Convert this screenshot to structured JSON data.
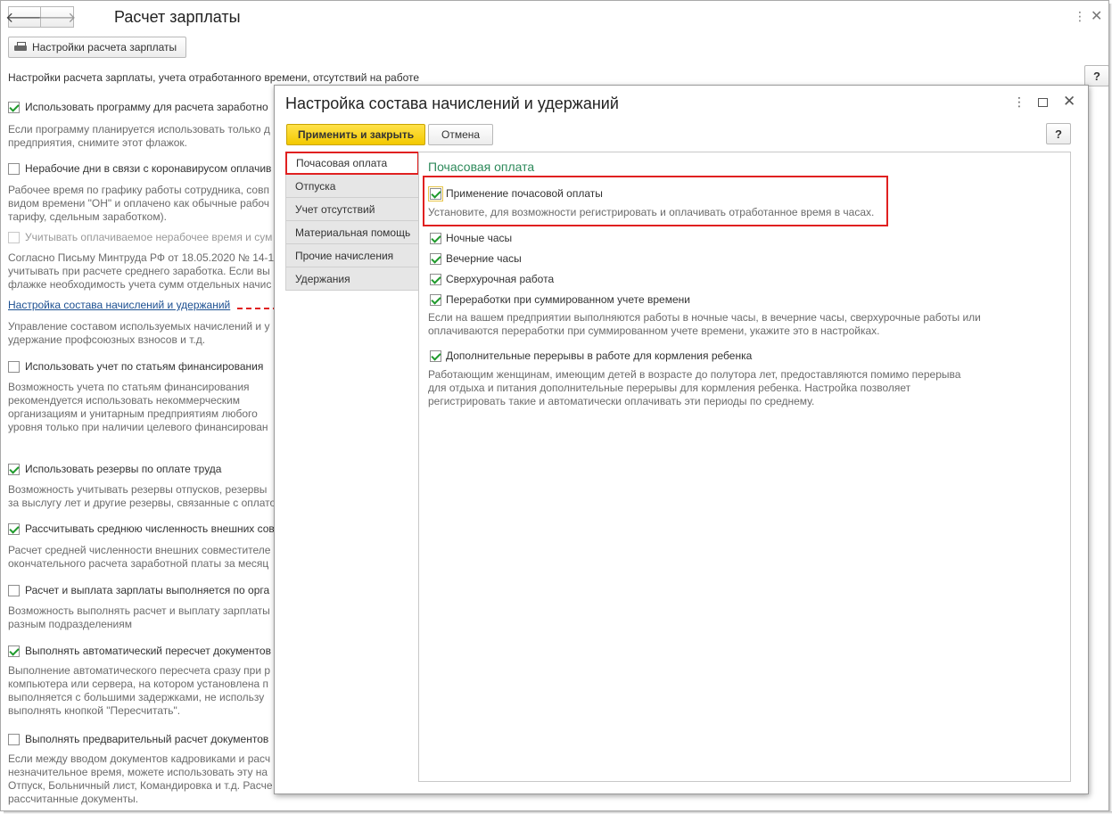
{
  "header": {
    "title": "Расчет зарплаты",
    "settings_button": "Настройки расчета зарплаты",
    "description": "Настройки расчета зарплаты, учета отработанного времени, отсутствий на работе",
    "help": "?"
  },
  "main": {
    "items": [
      {
        "label": "Использовать программу для расчета заработно",
        "checked": true,
        "desc": [
          "Если программу планируется использовать только д",
          "предприятия, снимите этот флажок."
        ]
      },
      {
        "label": "Нерабочие дни в связи с коронавирусом оплачив",
        "checked": false,
        "desc": [
          "Рабочее время по графику работы сотрудника, совп",
          "видом времени \"ОН\" и оплачено как обычные рабоч",
          "тарифу, сдельным заработком)."
        ]
      },
      {
        "label": "Учитывать оплачиваемое нерабочее время и сум",
        "checked": false,
        "disabled": true,
        "desc": [
          "Согласно Письму Минтруда РФ от 18.05.2020 № 14-1",
          "учитывать при расчете среднего заработка. Если вы",
          "флажке необходимость учета сумм отдельных начис"
        ]
      },
      {
        "label": "Использовать учет по статьям финансирования",
        "checked": false,
        "desc": [
          "Возможность учета по статьям финансирования",
          "рекомендуется использовать некоммерческим",
          "организациям и унитарным предприятиям любого",
          "уровня только при наличии целевого финансирован"
        ]
      },
      {
        "label": "Использовать резервы по оплате труда",
        "checked": true,
        "desc": [
          "Возможность учитывать резервы отпусков,  резервы",
          "за выслугу лет и другие резервы, связанные с оплато"
        ]
      },
      {
        "label": "Рассчитывать среднюю численность внешних сов",
        "checked": true,
        "desc": [
          "Расчет средней численности внешних совместителе",
          "окончательного расчета заработной платы за месяц"
        ]
      },
      {
        "label": "Расчет и выплата зарплаты выполняется по орга",
        "checked": false,
        "desc": [
          "Возможность выполнять расчет и выплату зарплаты",
          "разным подразделениям"
        ]
      },
      {
        "label": "Выполнять автоматический пересчет документов",
        "checked": true,
        "desc": [
          "Выполнение автоматического пересчета сразу при р",
          "компьютера или сервера, на котором установлена п",
          "выполняется с большими задержками, не использу",
          "выполнять кнопкой \"Пересчитать\"."
        ]
      },
      {
        "label": "Выполнять предварительный расчет документов",
        "checked": false,
        "desc": [
          "Если между вводом документов кадровиками и расч",
          "незначительное время, можете использовать эту на",
          "Отпуск, Больничный лист, Командировка и т.д. Расче",
          "рассчитанные документы."
        ]
      }
    ],
    "link": "Настройка состава начислений и удержаний",
    "link_desc": [
      "Управление составом используемых начислений и у",
      "удержание профсоюзных взносов и т.д."
    ]
  },
  "dialog": {
    "title": "Настройка состава начислений и удержаний",
    "apply_button": "Применить и закрыть",
    "cancel_button": "Отмена",
    "help": "?",
    "tabs": [
      "Почасовая оплата",
      "Отпуска",
      "Учет отсутствий",
      "Материальная помощь",
      "Прочие начисления",
      "Удержания"
    ],
    "active_tab": "Почасовая оплата",
    "panel": {
      "heading": "Почасовая оплата",
      "hourly": {
        "label": "Применение почасовой оплаты",
        "checked": true,
        "desc": "Установите, для возможности регистрировать и оплачивать отработанное время в часах."
      },
      "night": {
        "label": "Ночные часы",
        "checked": true
      },
      "evening": {
        "label": "Вечерние часы",
        "checked": true
      },
      "overtime": {
        "label": "Сверхурочная работа",
        "checked": true
      },
      "summed": {
        "label": "Переработки при суммированном учете времени",
        "checked": true,
        "desc": [
          "Если на вашем предприятии выполняются работы в ночные часы, в вечерние часы, сверхурочные работы или",
          "оплачиваются переработки при суммированном учете времени, укажите это в настройках."
        ]
      },
      "feeding": {
        "label": "Дополнительные перерывы в работе для кормления ребенка",
        "checked": true,
        "desc": [
          "Работающим женщинам, имеющим детей в возрасте до полутора лет, предоставляются помимо перерыва",
          "для отдыха и питания дополнительные перерывы для кормления ребенка. Настройка позволяет",
          "регистрировать такие и автоматически оплачивать эти периоды по среднему."
        ]
      }
    }
  }
}
